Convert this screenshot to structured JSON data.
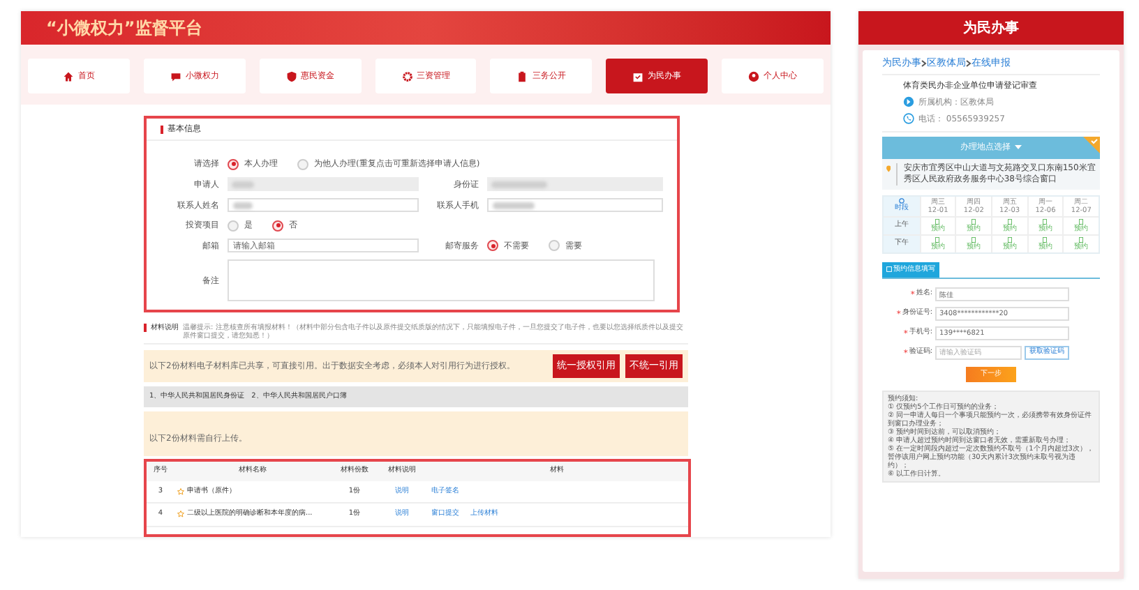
{
  "platform": {
    "title": "“小微权力”监督平台"
  },
  "nav": [
    {
      "label": "首页",
      "kind": "home",
      "selected": false
    },
    {
      "label": "小微权力",
      "kind": "chat",
      "selected": false
    },
    {
      "label": "惠民资金",
      "kind": "shield",
      "selected": false
    },
    {
      "label": "三资管理",
      "kind": "gear",
      "selected": false
    },
    {
      "label": "三务公开",
      "kind": "clipboard",
      "selected": false
    },
    {
      "label": "为民办事",
      "kind": "calendar",
      "selected": true
    },
    {
      "label": "个人中心",
      "kind": "user",
      "selected": false
    }
  ],
  "basic_info": {
    "heading": "基本信息",
    "applicant_choice": {
      "label": "请选择",
      "options": [
        {
          "label": "本人办理",
          "selected": true
        },
        {
          "label": "为他人办理(重复点击可重新选择申请人信息)",
          "selected": false
        }
      ]
    },
    "applicant": {
      "label": "申请人"
    },
    "id_card": {
      "label": "身份证"
    },
    "contact_name": {
      "label": "联系人姓名"
    },
    "contact_phone": {
      "label": "联系人手机"
    },
    "investment": {
      "label": "投资项目",
      "options": [
        {
          "label": "是",
          "selected": false
        },
        {
          "label": "否",
          "selected": true
        }
      ]
    },
    "email": {
      "label": "邮箱",
      "placeholder": "请输入邮箱"
    },
    "mail_service": {
      "label": "邮寄服务",
      "options": [
        {
          "label": "不需要",
          "selected": true
        },
        {
          "label": "需要",
          "selected": false
        }
      ]
    },
    "remarks": {
      "label": "备注"
    }
  },
  "materials": {
    "heading": "材料说明",
    "tip": "温馨提示: 注意核查所有填报材料！（材料中部分包含电子件以及原件提交纸质版的情况下，只能填报电子件，一旦您提交了电子件，也要以您选择纸质件以及提交原件窗口提交，请您知悉！）",
    "shared_notice": "以下2份材料电子材料库已共享，可直接引用。出于数据安全考虑，必须本人对引用行为进行授权。",
    "buttons": [
      "统一授权引用",
      "不统一引用"
    ],
    "shared_list": "1、中华人民共和国居民身份证　2、中华人民共和国居民户口簿",
    "upload_notice": "以下2份材料需自行上传。",
    "table": {
      "columns": [
        "序号",
        "材料名称",
        "材料份数",
        "材料说明",
        "材料"
      ],
      "rows": [
        {
          "no": "3",
          "name": "申请书（原件）",
          "count": "1份",
          "note": "说明",
          "actions": [
            "电子签名"
          ]
        },
        {
          "no": "4",
          "name": "二级以上医院的明确诊断和本年度的病...",
          "count": "1份",
          "note": "说明",
          "actions": [
            "窗口提交",
            "上传材料"
          ]
        }
      ]
    }
  },
  "mobile": {
    "title": "为民办事",
    "breadcrumb": [
      "为民办事",
      "区教体局",
      "在线申报"
    ],
    "service_name": "体育类民办非企业单位申请登记审查",
    "agency": "所属机构：区教体局",
    "phone": "电话： 05565939257",
    "location_select": "办理地点选择",
    "address": "安庆市宜秀区中山大道与文苑路交叉口东南150米宜秀区人民政府政务服务中心38号综合窗口",
    "calendar": {
      "corner": "时段",
      "days": [
        {
          "week": "周三",
          "date": "12-01"
        },
        {
          "week": "周四",
          "date": "12-02"
        },
        {
          "week": "周五",
          "date": "12-03"
        },
        {
          "week": "周一",
          "date": "12-06"
        },
        {
          "week": "周二",
          "date": "12-07"
        }
      ],
      "rows": [
        {
          "label": "上午",
          "slots": [
            "预约",
            "预约",
            "预约",
            "预约",
            "预约"
          ]
        },
        {
          "label": "下午",
          "slots": [
            "预约",
            "预约",
            "预约",
            "预约",
            "预约"
          ]
        }
      ]
    },
    "form_tab": "预约信息填写",
    "fields": [
      {
        "mark": "*",
        "label": "姓名:",
        "value": "陈佳"
      },
      {
        "mark": "*",
        "label": "身份证号:",
        "value": "3408************20"
      },
      {
        "mark": "*",
        "label": "手机号:",
        "value": "139****6821"
      },
      {
        "mark": "*",
        "label": "验证码:",
        "placeholder": "请输入验证码",
        "button": "获取验证码"
      }
    ],
    "next": "下一步",
    "notes": [
      "预约须知:",
      "① 仅预约5个工作日可预约的业务；",
      "② 同一申请人每日一个事项只能预约一次，必须携带有效身份证件到窗口办理业务；",
      "③ 预约时间到达前，可以取消预约；",
      "④ 申请人超过预约时间到达窗口者无效，需重新取号办理；",
      "⑤ 在一定时间段内超过一定次数预约不取号（1个月内超过3次），暂停该用户网上预约功能（30天内累计3次预约未取号视为违约）；",
      "⑥ 以工作日计算。"
    ]
  }
}
